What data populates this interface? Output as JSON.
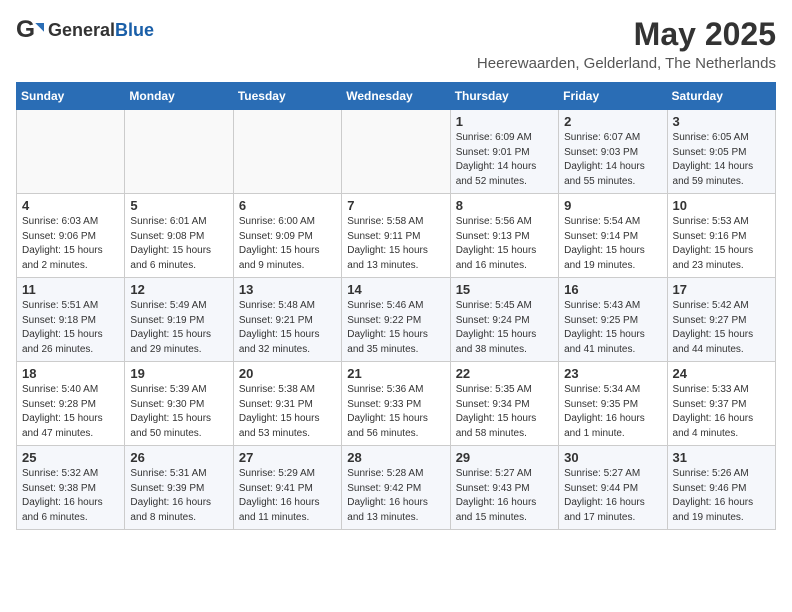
{
  "header": {
    "logo_general": "General",
    "logo_blue": "Blue",
    "title": "May 2025",
    "location": "Heerewaarden, Gelderland, The Netherlands"
  },
  "weekdays": [
    "Sunday",
    "Monday",
    "Tuesday",
    "Wednesday",
    "Thursday",
    "Friday",
    "Saturday"
  ],
  "weeks": [
    [
      {
        "day": "",
        "info": ""
      },
      {
        "day": "",
        "info": ""
      },
      {
        "day": "",
        "info": ""
      },
      {
        "day": "",
        "info": ""
      },
      {
        "day": "1",
        "info": "Sunrise: 6:09 AM\nSunset: 9:01 PM\nDaylight: 14 hours\nand 52 minutes."
      },
      {
        "day": "2",
        "info": "Sunrise: 6:07 AM\nSunset: 9:03 PM\nDaylight: 14 hours\nand 55 minutes."
      },
      {
        "day": "3",
        "info": "Sunrise: 6:05 AM\nSunset: 9:05 PM\nDaylight: 14 hours\nand 59 minutes."
      }
    ],
    [
      {
        "day": "4",
        "info": "Sunrise: 6:03 AM\nSunset: 9:06 PM\nDaylight: 15 hours\nand 2 minutes."
      },
      {
        "day": "5",
        "info": "Sunrise: 6:01 AM\nSunset: 9:08 PM\nDaylight: 15 hours\nand 6 minutes."
      },
      {
        "day": "6",
        "info": "Sunrise: 6:00 AM\nSunset: 9:09 PM\nDaylight: 15 hours\nand 9 minutes."
      },
      {
        "day": "7",
        "info": "Sunrise: 5:58 AM\nSunset: 9:11 PM\nDaylight: 15 hours\nand 13 minutes."
      },
      {
        "day": "8",
        "info": "Sunrise: 5:56 AM\nSunset: 9:13 PM\nDaylight: 15 hours\nand 16 minutes."
      },
      {
        "day": "9",
        "info": "Sunrise: 5:54 AM\nSunset: 9:14 PM\nDaylight: 15 hours\nand 19 minutes."
      },
      {
        "day": "10",
        "info": "Sunrise: 5:53 AM\nSunset: 9:16 PM\nDaylight: 15 hours\nand 23 minutes."
      }
    ],
    [
      {
        "day": "11",
        "info": "Sunrise: 5:51 AM\nSunset: 9:18 PM\nDaylight: 15 hours\nand 26 minutes."
      },
      {
        "day": "12",
        "info": "Sunrise: 5:49 AM\nSunset: 9:19 PM\nDaylight: 15 hours\nand 29 minutes."
      },
      {
        "day": "13",
        "info": "Sunrise: 5:48 AM\nSunset: 9:21 PM\nDaylight: 15 hours\nand 32 minutes."
      },
      {
        "day": "14",
        "info": "Sunrise: 5:46 AM\nSunset: 9:22 PM\nDaylight: 15 hours\nand 35 minutes."
      },
      {
        "day": "15",
        "info": "Sunrise: 5:45 AM\nSunset: 9:24 PM\nDaylight: 15 hours\nand 38 minutes."
      },
      {
        "day": "16",
        "info": "Sunrise: 5:43 AM\nSunset: 9:25 PM\nDaylight: 15 hours\nand 41 minutes."
      },
      {
        "day": "17",
        "info": "Sunrise: 5:42 AM\nSunset: 9:27 PM\nDaylight: 15 hours\nand 44 minutes."
      }
    ],
    [
      {
        "day": "18",
        "info": "Sunrise: 5:40 AM\nSunset: 9:28 PM\nDaylight: 15 hours\nand 47 minutes."
      },
      {
        "day": "19",
        "info": "Sunrise: 5:39 AM\nSunset: 9:30 PM\nDaylight: 15 hours\nand 50 minutes."
      },
      {
        "day": "20",
        "info": "Sunrise: 5:38 AM\nSunset: 9:31 PM\nDaylight: 15 hours\nand 53 minutes."
      },
      {
        "day": "21",
        "info": "Sunrise: 5:36 AM\nSunset: 9:33 PM\nDaylight: 15 hours\nand 56 minutes."
      },
      {
        "day": "22",
        "info": "Sunrise: 5:35 AM\nSunset: 9:34 PM\nDaylight: 15 hours\nand 58 minutes."
      },
      {
        "day": "23",
        "info": "Sunrise: 5:34 AM\nSunset: 9:35 PM\nDaylight: 16 hours\nand 1 minute."
      },
      {
        "day": "24",
        "info": "Sunrise: 5:33 AM\nSunset: 9:37 PM\nDaylight: 16 hours\nand 4 minutes."
      }
    ],
    [
      {
        "day": "25",
        "info": "Sunrise: 5:32 AM\nSunset: 9:38 PM\nDaylight: 16 hours\nand 6 minutes."
      },
      {
        "day": "26",
        "info": "Sunrise: 5:31 AM\nSunset: 9:39 PM\nDaylight: 16 hours\nand 8 minutes."
      },
      {
        "day": "27",
        "info": "Sunrise: 5:29 AM\nSunset: 9:41 PM\nDaylight: 16 hours\nand 11 minutes."
      },
      {
        "day": "28",
        "info": "Sunrise: 5:28 AM\nSunset: 9:42 PM\nDaylight: 16 hours\nand 13 minutes."
      },
      {
        "day": "29",
        "info": "Sunrise: 5:27 AM\nSunset: 9:43 PM\nDaylight: 16 hours\nand 15 minutes."
      },
      {
        "day": "30",
        "info": "Sunrise: 5:27 AM\nSunset: 9:44 PM\nDaylight: 16 hours\nand 17 minutes."
      },
      {
        "day": "31",
        "info": "Sunrise: 5:26 AM\nSunset: 9:46 PM\nDaylight: 16 hours\nand 19 minutes."
      }
    ]
  ]
}
